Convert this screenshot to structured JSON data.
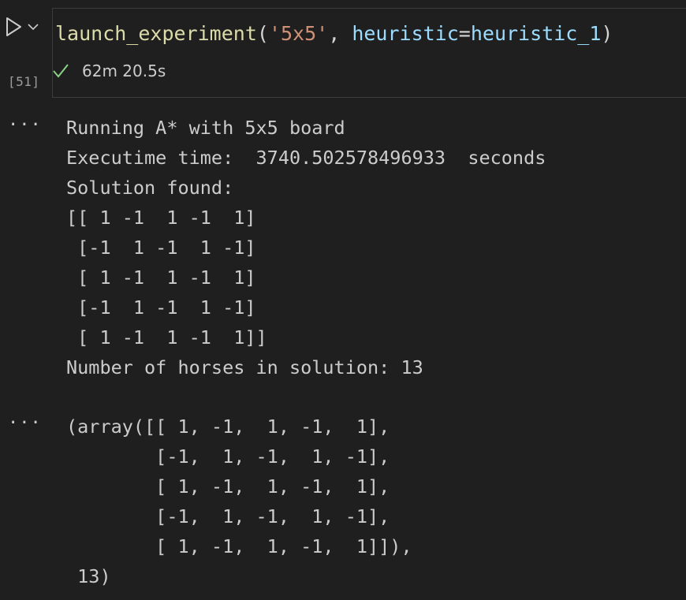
{
  "cell": {
    "execution_count": "[51]",
    "code": {
      "fn": "launch_experiment",
      "open": "(",
      "arg_str": "'5x5'",
      "sep": ", ",
      "param": "heuristic",
      "eq": "=",
      "param_value": "heuristic_1",
      "close": ")"
    },
    "status": {
      "icon": "check-icon",
      "duration": "62m 20.5s"
    }
  },
  "outputs": {
    "ellipsis": "···",
    "stdout_lines": [
      "Running A* with 5x5 board",
      "Executime time:  3740.502578496933  seconds",
      "Solution found:",
      "[[ 1 -1  1 -1  1]",
      " [-1  1 -1  1 -1]",
      " [ 1 -1  1 -1  1]",
      " [-1  1 -1  1 -1]",
      " [ 1 -1  1 -1  1]]",
      "Number of horses in solution: 13"
    ],
    "result_lines": [
      "(array([[ 1, -1,  1, -1,  1],",
      "        [-1,  1, -1,  1, -1],",
      "        [ 1, -1,  1, -1,  1],",
      "        [-1,  1, -1,  1, -1],",
      "        [ 1, -1,  1, -1,  1]]),",
      " 13)"
    ]
  },
  "colors": {
    "background": "#1f1f1f",
    "text": "#cccccc",
    "function": "#dcdcaa",
    "string": "#ce9178",
    "parameter": "#9cdcfe",
    "success": "#89d185"
  }
}
